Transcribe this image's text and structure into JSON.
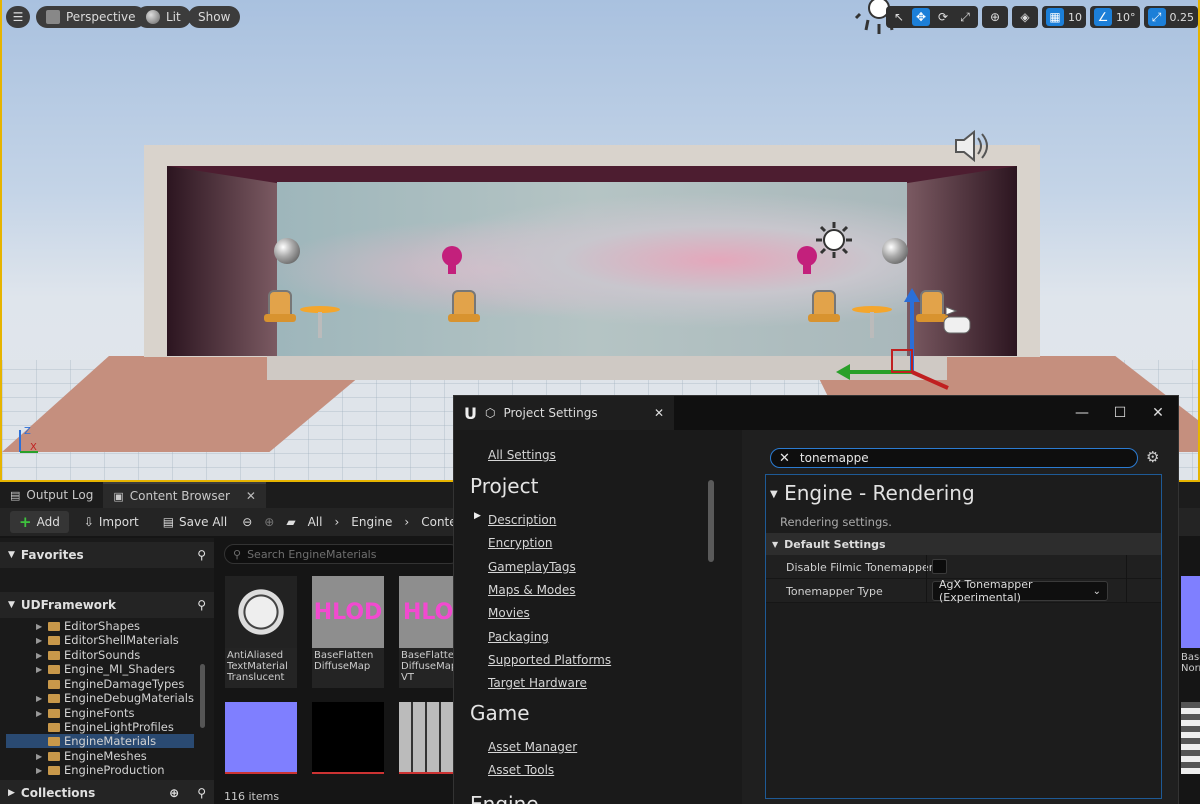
{
  "viewport": {
    "hamburger_icon": "menu-icon",
    "perspective_label": "Perspective",
    "lit_label": "Lit",
    "show_label": "Show",
    "grid_snap": "10",
    "rot_snap": "10°",
    "scale_snap": "0.25"
  },
  "tabs": {
    "output_log": "Output Log",
    "content_browser": "Content Browser"
  },
  "cb_toolbar": {
    "add": "Add",
    "import": "Import",
    "save_all": "Save All",
    "crumbs": [
      "All",
      "Engine",
      "Content"
    ]
  },
  "sidebar": {
    "favorites": "Favorites",
    "project": "UDFramework",
    "collections": "Collections",
    "folders": [
      "EditorShapes",
      "EditorShellMaterials",
      "EditorSounds",
      "Engine_MI_Shaders",
      "EngineDamageTypes",
      "EngineDebugMaterials",
      "EngineFonts",
      "EngineLightProfiles",
      "EngineMaterials",
      "EngineMeshes",
      "EngineProduction"
    ],
    "selected": "EngineMaterials"
  },
  "assets": {
    "search_placeholder": "Search EngineMaterials",
    "tiles": [
      {
        "label": "AntiAliased\nTextMaterial\nTranslucent"
      },
      {
        "label": "BaseFlatten\nDiffuseMap"
      },
      {
        "label": "BaseFlatten\nDiffuseMap\nVT"
      }
    ],
    "hlod_text": "HLOD",
    "count": "116 items",
    "partial_right": "Base\nNorm"
  },
  "project_settings": {
    "title": "Project Settings",
    "all_settings": "All Settings",
    "project_heading": "Project",
    "project_links": [
      "Description",
      "Encryption",
      "GameplayTags",
      "Maps & Modes",
      "Movies",
      "Packaging",
      "Supported Platforms",
      "Target Hardware"
    ],
    "game_heading": "Game",
    "game_links": [
      "Asset Manager",
      "Asset Tools"
    ],
    "partial_heading": "Engine",
    "filter_value": "tonemappe",
    "section_title": "Engine - Rendering",
    "section_desc": "Rendering settings.",
    "subcategory": "Default Settings",
    "rows": [
      {
        "name": "Disable Filmic Tonemapper",
        "type": "checkbox",
        "checked": false
      },
      {
        "name": "Tonemapper Type",
        "type": "dropdown",
        "value": "AgX Tonemapper (Experimental)"
      }
    ]
  },
  "colors": {
    "accent": "#1c7fd8",
    "selection": "#2a4a72",
    "viewport_border": "#e6b400",
    "add_plus": "#3ec33e"
  }
}
